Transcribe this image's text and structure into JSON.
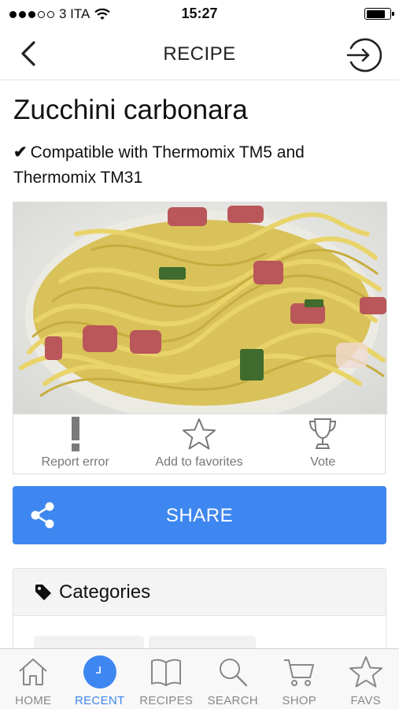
{
  "status_bar": {
    "carrier": "3 ITA",
    "time": "15:27",
    "signal_strength": 3,
    "battery_level": 0.8
  },
  "header": {
    "title": "RECIPE",
    "back_icon": "chevron-left-icon",
    "login_icon": "login-icon"
  },
  "recipe": {
    "title": "Zucchini carbonara",
    "compatibility_check": "✔",
    "compatibility": "Compatible with Thermomix TM5 and Thermomix TM31",
    "image_description": "spaghetti with zucchini and pancetta"
  },
  "actions": [
    {
      "label": "Report error",
      "icon": "exclamation-icon"
    },
    {
      "label": "Add to favorites",
      "icon": "star-outline-icon"
    },
    {
      "label": "Vote",
      "icon": "trophy-icon"
    }
  ],
  "share": {
    "label": "SHARE",
    "icon": "share-icon",
    "color": "#3f87f0"
  },
  "categories": {
    "title": "Categories",
    "icon": "tag-icon"
  },
  "tabbar": {
    "active_color": "#3f87f0",
    "tabs": [
      {
        "label": "HOME",
        "icon": "home-icon",
        "active": false
      },
      {
        "label": "RECENT",
        "icon": "clock-icon",
        "active": true
      },
      {
        "label": "RECIPES",
        "icon": "book-icon",
        "active": false
      },
      {
        "label": "SEARCH",
        "icon": "search-icon",
        "active": false
      },
      {
        "label": "SHOP",
        "icon": "cart-icon",
        "active": false
      },
      {
        "label": "FAVS",
        "icon": "star-icon",
        "active": false
      }
    ]
  }
}
